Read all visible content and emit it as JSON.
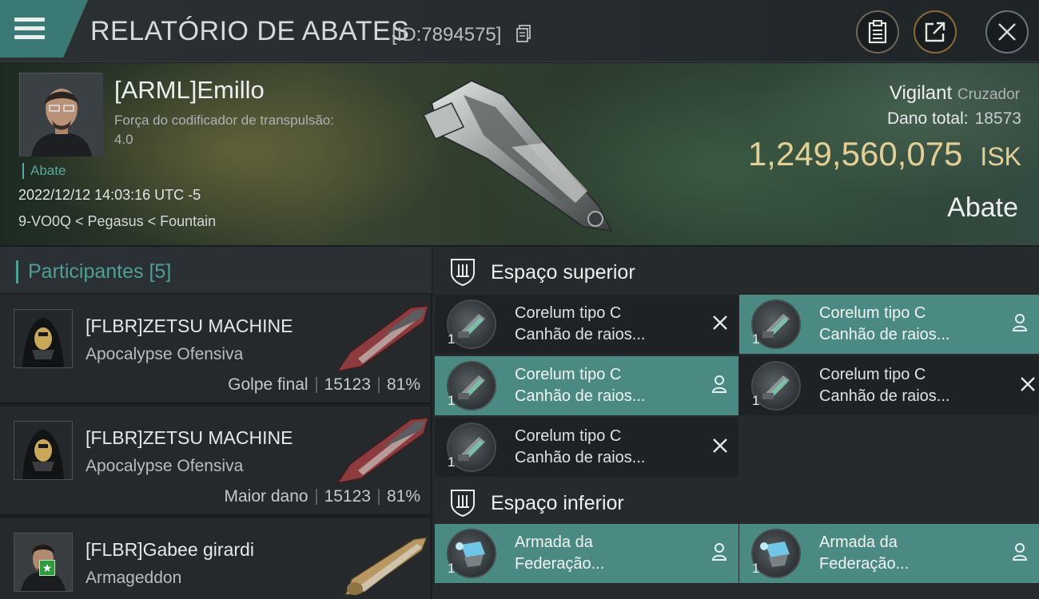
{
  "header": {
    "title": "RELATÓRIO DE ABATES",
    "report_id": "[ID:7894575]"
  },
  "victim": {
    "pilot_name": "[ARML]Emillo",
    "warp_label": "Força do codificador de transpulsão:",
    "warp_value": "4.0",
    "tag": "Abate",
    "datetime": "2022/12/12 14:03:16 UTC -5",
    "location": "9-VO0Q < Pegasus < Fountain",
    "ship": "Vigilant",
    "ship_class": "Cruzador",
    "damage_label": "Dano total:",
    "damage_value": "18573",
    "isk_value": "1,249,560,075",
    "isk_unit": "ISK",
    "kill_type": "Abate"
  },
  "participants": {
    "title": "Participantes [5]",
    "items": [
      {
        "name": "[FLBR]ZETSU MACHINE",
        "ship": "Apocalypse Ofensiva",
        "role": "Golpe final",
        "damage": "15123",
        "percent": "81%"
      },
      {
        "name": "[FLBR]ZETSU MACHINE",
        "ship": "Apocalypse Ofensiva",
        "role": "Maior dano",
        "damage": "15123",
        "percent": "81%"
      },
      {
        "name": "[FLBR]Gabee girardi",
        "ship": "Armageddon",
        "role": "",
        "damage": "",
        "percent": ""
      }
    ]
  },
  "fitting": {
    "high_label": "Espaço superior",
    "low_label": "Espaço inferior",
    "high_slots": [
      {
        "qty": "1",
        "line1": "Corelum tipo C",
        "line2": "Canhão de raios...",
        "state": "destroyed"
      },
      {
        "qty": "1",
        "line1": "Corelum tipo C",
        "line2": "Canhão de raios...",
        "state": "dropped"
      },
      {
        "qty": "1",
        "line1": "Corelum tipo C",
        "line2": "Canhão de raios...",
        "state": "dropped"
      },
      {
        "qty": "1",
        "line1": "Corelum tipo C",
        "line2": "Canhão de raios...",
        "state": "destroyed"
      },
      {
        "qty": "1",
        "line1": "Corelum tipo C",
        "line2": "Canhão de raios...",
        "state": "destroyed"
      }
    ],
    "low_slots": [
      {
        "qty": "1",
        "line1": "Armada da",
        "line2": "Federação...",
        "state": "dropped"
      },
      {
        "qty": "1",
        "line1": "Armada da",
        "line2": "Federação...",
        "state": "dropped"
      }
    ]
  },
  "colors": {
    "accent_teal": "#4a8a82",
    "isk_gold": "#e4cf95",
    "active_slot": "#4a8a82"
  }
}
